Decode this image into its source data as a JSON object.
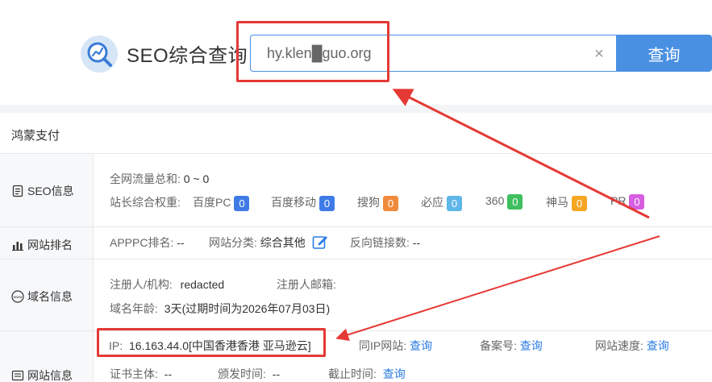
{
  "header": {
    "brand": "SEO综合查询",
    "search_value": "hy.klen█guo.org",
    "clear_icon": "×",
    "search_button": "查询"
  },
  "site": {
    "name": "鸿蒙支付"
  },
  "seo": {
    "label": "SEO信息",
    "traffic_label": "全网流量总和:",
    "traffic_value": "0 ~ 0",
    "weight_label": "站长综合权重:",
    "engines": [
      {
        "name": "百度PC",
        "value": "0",
        "color": "#3e7be6"
      },
      {
        "name": "百度移动",
        "value": "0",
        "color": "#3e7be6"
      },
      {
        "name": "搜狗",
        "value": "0",
        "color": "#f08a3c"
      },
      {
        "name": "必应",
        "value": "0",
        "color": "#5fb6e8"
      },
      {
        "name": "360",
        "value": "0",
        "color": "#3fbf5f"
      },
      {
        "name": "神马",
        "value": "0",
        "color": "#f5a623"
      },
      {
        "name": "PR",
        "value": "0",
        "color": "#d55fe0"
      }
    ]
  },
  "rank": {
    "label": "网站排名",
    "apppc_label": "APPPC排名:",
    "apppc_value": "--",
    "category_label": "网站分类:",
    "category_value": "综合其他",
    "backlinks_label": "反向链接数:",
    "backlinks_value": "--"
  },
  "domain": {
    "label": "域名信息",
    "registrant_label": "注册人/机构:",
    "registrant_value": "redacted",
    "email_label": "注册人邮箱:",
    "age_label": "域名年龄:",
    "age_value": "3天",
    "expire_text": "(过期时间为2026年07月03日)"
  },
  "siteinfo": {
    "label": "网站信息",
    "ip_label": "IP:",
    "ip_value": "16.163.44.0[中国香港香港 亚马逊云]",
    "same_ip_label": "同IP网站:",
    "same_ip_link": "查询",
    "icp_label": "备案号:",
    "icp_link": "查询",
    "speed_label": "网站速度:",
    "speed_link": "查询",
    "cert_subject_label": "证书主体:",
    "cert_subject_value": "--",
    "issue_label": "颁发时间:",
    "issue_value": "--",
    "expiry_label": "截止时间:",
    "expiry_link": "查询"
  },
  "colors": {
    "accent": "#4a90e2",
    "annotation": "#e53935",
    "link": "#2a7ae2"
  }
}
